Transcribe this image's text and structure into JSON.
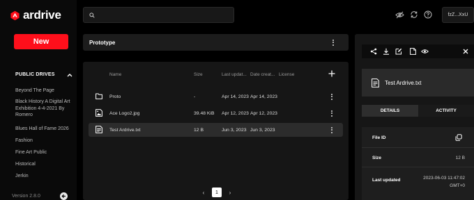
{
  "app": {
    "name": "ardrive",
    "brand_color": "#ff0f1b"
  },
  "sidebar": {
    "new_label": "New",
    "public_drives_label": "PUBLIC DRIVES",
    "drives": [
      "Beyond The Page",
      "Black History A Digital Art Exhibition 4-4-2021 By Romero",
      "Blues Hall of Fame 2026",
      "Fashion",
      "Fine Art Public",
      "Historical",
      "Jerkin"
    ],
    "version": "Version 2.8.0"
  },
  "topbar": {
    "search_placeholder": "",
    "account_label": "fzZ...XxU",
    "icons": [
      "eye-off-icon",
      "sync-icon",
      "help-icon"
    ]
  },
  "main": {
    "breadcrumb": "Prototype",
    "columns": [
      "Name",
      "Size",
      "Last updat...",
      "Date creat...",
      "License"
    ],
    "rows": [
      {
        "icon": "folder-icon",
        "name": "Proto",
        "size": "-",
        "last_updated": "Apr 14, 2023",
        "date_created": "Apr 14, 2023",
        "license": "",
        "selected": false
      },
      {
        "icon": "image-file-icon",
        "name": "Ace Logo2.jpg",
        "size": "39.48 KiB",
        "last_updated": "Apr 12, 2023",
        "date_created": "Apr 12, 2023",
        "license": "",
        "selected": false
      },
      {
        "icon": "text-file-icon",
        "name": "Test Ardrive.txt",
        "size": "12 B",
        "last_updated": "Jun 3, 2023",
        "date_created": "Jun 3, 2023",
        "license": "",
        "selected": true
      }
    ],
    "pagination": {
      "current_page": "1",
      "prev": "‹",
      "next": "›"
    }
  },
  "details": {
    "toolbar_icons": [
      "share-icon",
      "download-icon",
      "edit-icon",
      "file-icon",
      "preview-icon",
      "close-icon"
    ],
    "file_name": "Test Ardrive.txt",
    "tabs": [
      "DETAILS",
      "ACTIVITY"
    ],
    "active_tab": "DETAILS",
    "fields": [
      {
        "label": "File ID",
        "value": ""
      },
      {
        "label": "Size",
        "value": "12 B"
      },
      {
        "label": "Last updated",
        "value": "2023-06-03 11:47:02 GMT+0"
      }
    ]
  }
}
